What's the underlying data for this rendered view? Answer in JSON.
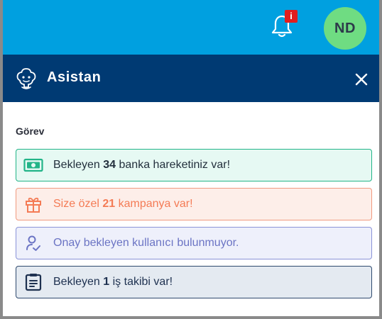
{
  "topbar": {
    "notification_badge": "i",
    "avatar_initials": "ND"
  },
  "panel": {
    "title": "Asistan",
    "section_title": "Görev",
    "tasks": [
      {
        "pre": "Bekleyen ",
        "bold": "34",
        "post": " banka hareketiniz var!",
        "icon": "money-icon"
      },
      {
        "pre": "Size özel ",
        "bold": "21",
        "post": " kampanya var!",
        "icon": "gift-icon"
      },
      {
        "pre": "Onay bekleyen kullanıcı bulunmuyor.",
        "bold": "",
        "post": "",
        "icon": "user-check-icon"
      },
      {
        "pre": "Bekleyen ",
        "bold": "1",
        "post": " iş takibi var!",
        "icon": "clipboard-icon"
      }
    ]
  },
  "colors": {
    "topbar": "#00a0e0",
    "header": "#003a73",
    "avatar": "#6fdc82",
    "badge": "#e21d1d"
  }
}
